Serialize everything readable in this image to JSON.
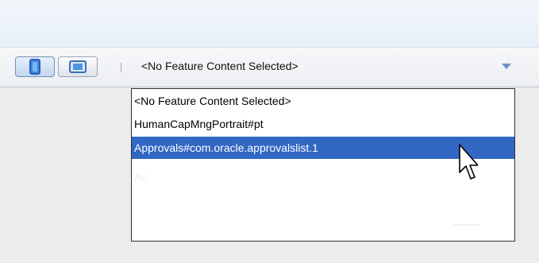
{
  "toolbar": {
    "view_modes": [
      {
        "name": "phone",
        "icon": "phone-icon",
        "active": true
      },
      {
        "name": "tablet",
        "icon": "tablet-icon",
        "active": false
      }
    ],
    "feature_select": {
      "value": "<No Feature Content Selected>"
    }
  },
  "dropdown": {
    "options": [
      {
        "label": "<No Feature Content Selected>",
        "selected": false
      },
      {
        "label": "HumanCapMngPortrait#pt",
        "selected": false
      },
      {
        "label": "Approvals#com.oracle.approvalslist.1",
        "selected": true
      },
      {
        "label": "Ac",
        "selected": false
      }
    ]
  },
  "colors": {
    "selection": "#3267c4",
    "accent": "#6e93c6"
  }
}
